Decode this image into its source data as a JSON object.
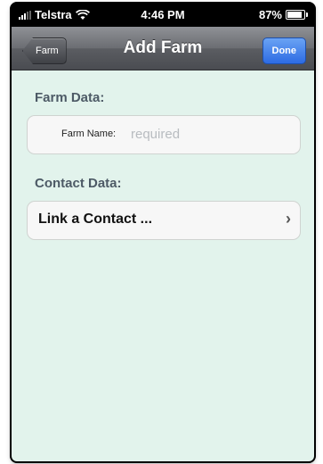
{
  "status_bar": {
    "carrier": "Telstra",
    "time": "4:46 PM",
    "battery_text": "87%",
    "battery_level": 0.87
  },
  "navbar": {
    "back_label": "Farm",
    "title": "Add Farm",
    "done_label": "Done"
  },
  "farm_section": {
    "header": "Farm Data:",
    "farm_name_label": "Farm Name:",
    "farm_name_value": "",
    "farm_name_placeholder": "required"
  },
  "contact_section": {
    "header": "Contact Data:",
    "link_label": "Link a Contact ...",
    "link_icon": "chevron-right-icon"
  },
  "colors": {
    "background": "#e2f3ec",
    "done_button": "#2d6be3",
    "section_label": "#4d5a66"
  }
}
